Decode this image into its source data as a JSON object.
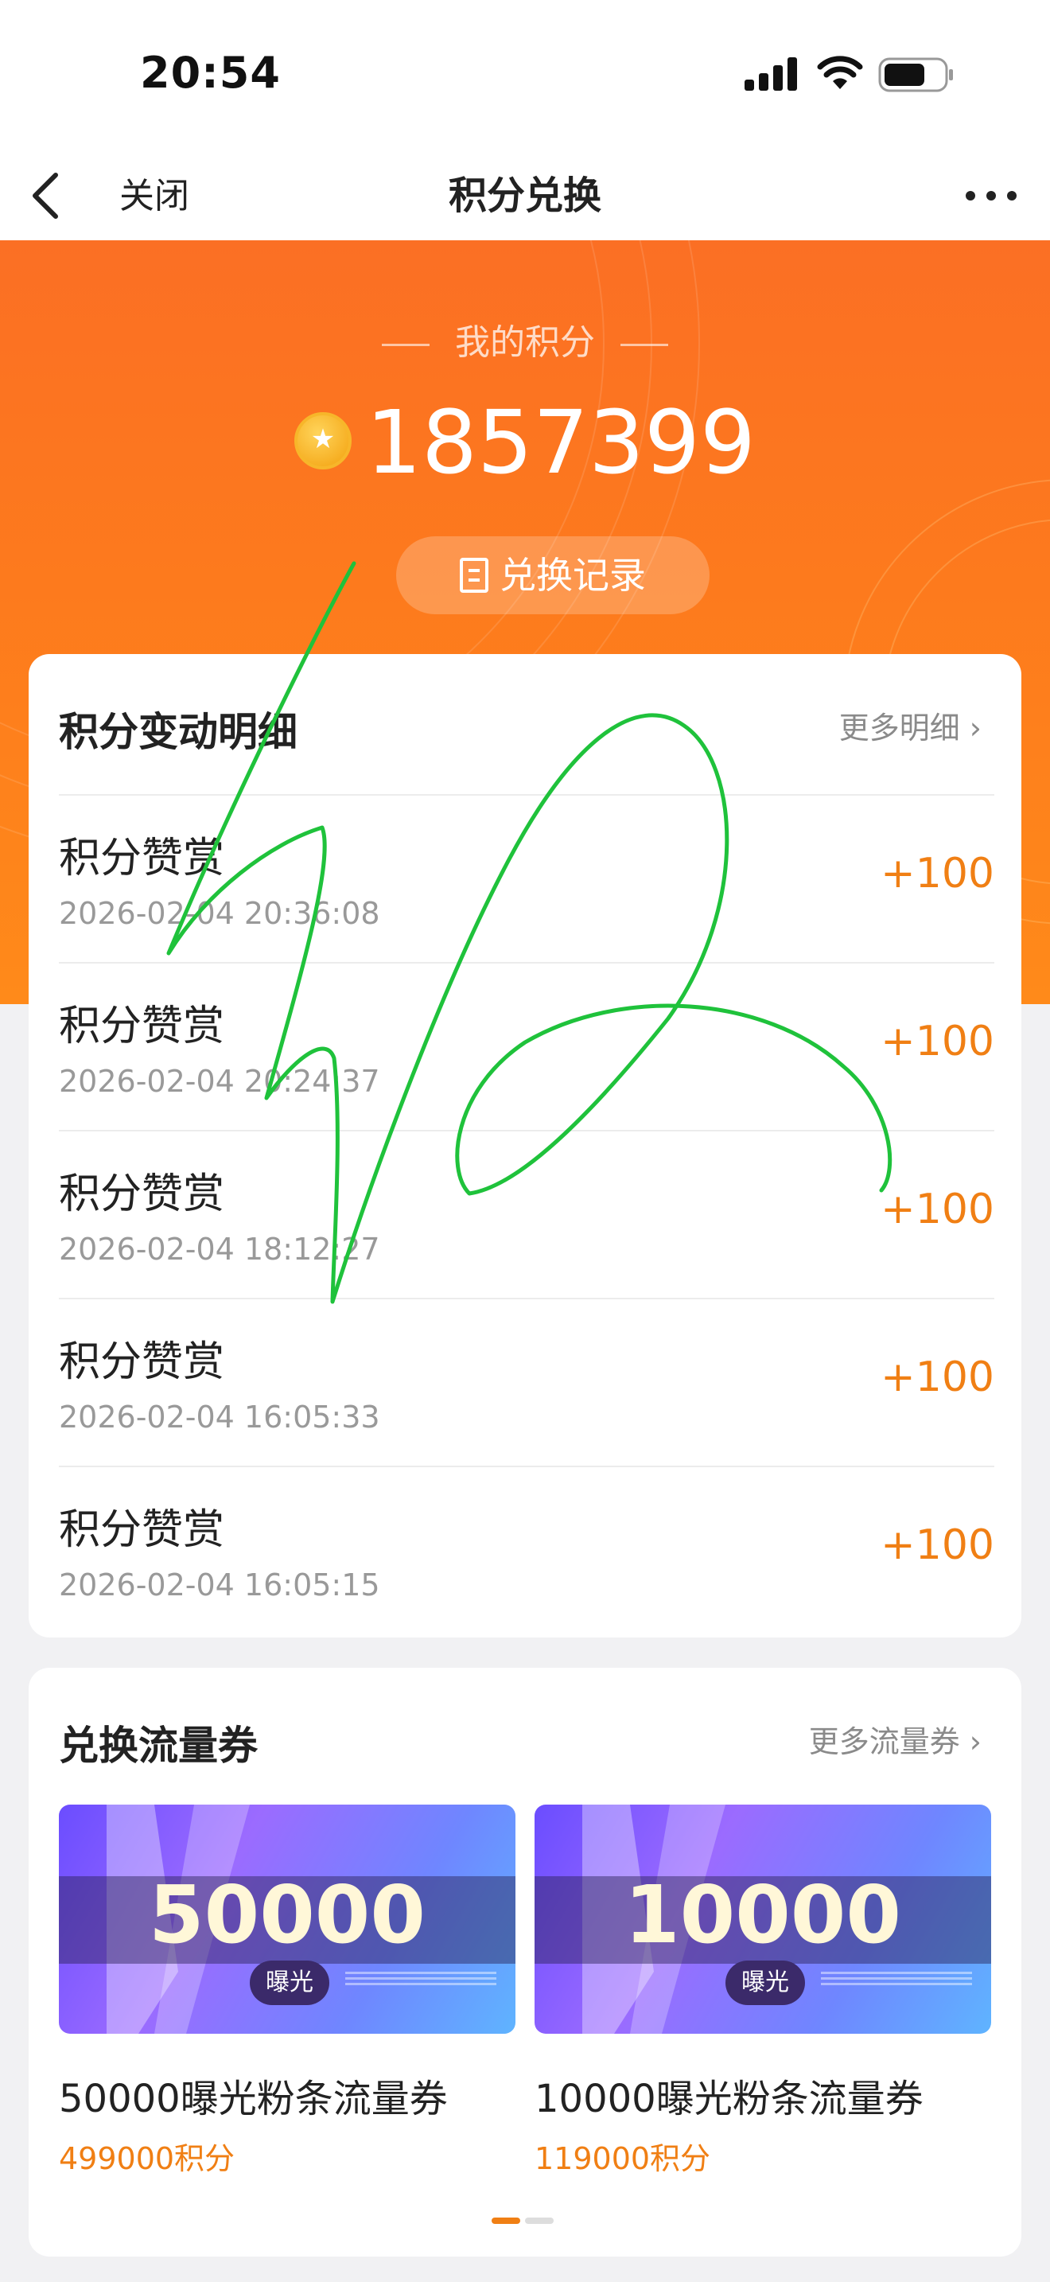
{
  "status_bar": {
    "time": "20:54"
  },
  "nav": {
    "close_label": "关闭",
    "title": "积分兑换"
  },
  "hero": {
    "label": "我的积分",
    "points": "1857399",
    "record_button": "兑换记录"
  },
  "details": {
    "heading": "积分变动明细",
    "more": "更多明细",
    "items": [
      {
        "name": "积分赞赏",
        "time": "2026-02-04 20:36:08",
        "value": "+100"
      },
      {
        "name": "积分赞赏",
        "time": "2026-02-04 20:24:37",
        "value": "+100"
      },
      {
        "name": "积分赞赏",
        "time": "2026-02-04 18:12:27",
        "value": "+100"
      },
      {
        "name": "积分赞赏",
        "time": "2026-02-04 16:05:33",
        "value": "+100"
      },
      {
        "name": "积分赞赏",
        "time": "2026-02-04 16:05:15",
        "value": "+100"
      }
    ]
  },
  "vouchers": {
    "heading": "兑换流量券",
    "more": "更多流量券",
    "items": [
      {
        "amount": "50000",
        "tag": "曝光",
        "name": "50000曝光粉条流量券",
        "cost": "499000积分"
      },
      {
        "amount": "10000",
        "tag": "曝光",
        "name": "10000曝光粉条流量券",
        "cost": "119000积分"
      }
    ]
  },
  "colors": {
    "accent": "#f07f14",
    "hero": "#fd7a1d",
    "scribble": "#1fc23b"
  }
}
